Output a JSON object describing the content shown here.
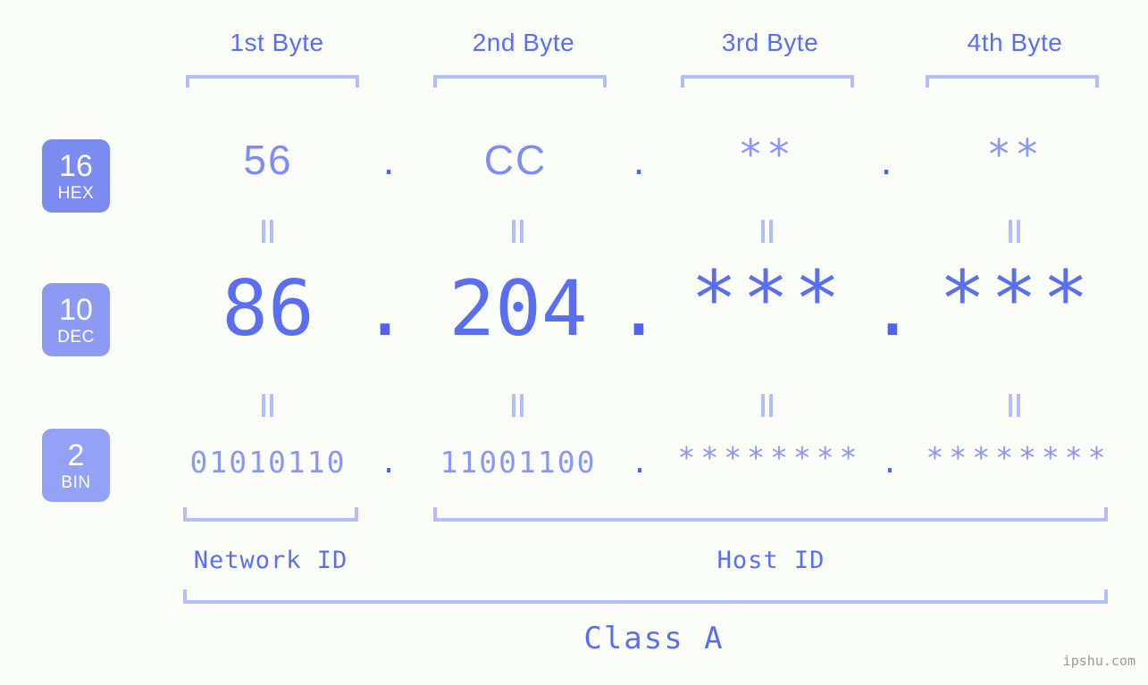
{
  "meta": {
    "background_color": "#fbfdf8",
    "accent_color": "#5a6ff0",
    "accent_light_color": "#b4bdfb",
    "badge_color_hex": "#7b8bf0",
    "badge_color_dec": "#8c9af3",
    "badge_color_bin": "#93a2f6",
    "separator": "."
  },
  "headers": {
    "byte1": "1st Byte",
    "byte2": "2nd Byte",
    "byte3": "3rd Byte",
    "byte4": "4th Byte"
  },
  "bases": {
    "hex": {
      "number": "16",
      "name": "HEX"
    },
    "dec": {
      "number": "10",
      "name": "DEC"
    },
    "bin": {
      "number": "2",
      "name": "BIN"
    }
  },
  "rows": {
    "hex": {
      "byte1": "56",
      "byte2": "CC",
      "byte3": "**",
      "byte4": "**"
    },
    "dec": {
      "byte1": "86",
      "byte2": "204",
      "byte3": "***",
      "byte4": "***"
    },
    "bin": {
      "byte1": "01010110",
      "byte2": "11001100",
      "byte3": "********",
      "byte4": "********"
    }
  },
  "separators": {
    "d1": ".",
    "d2": ".",
    "d3": "."
  },
  "segments": {
    "network_id": "Network ID",
    "host_id": "Host ID",
    "class": "Class A"
  },
  "watermark": "ipshu.com"
}
